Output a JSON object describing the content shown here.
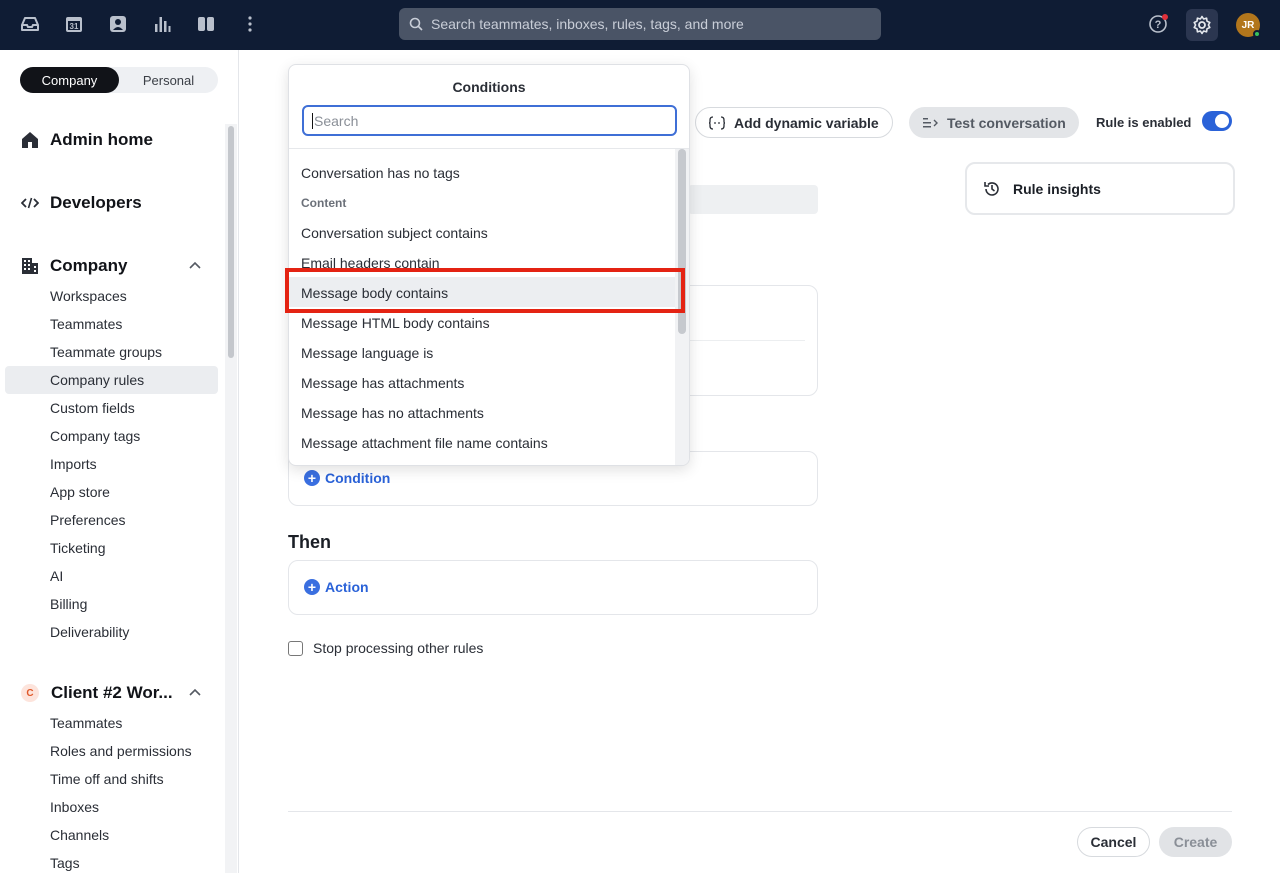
{
  "topbar": {
    "search_placeholder": "Search teammates, inboxes, rules, tags, and more",
    "avatar_initials": "JR",
    "calendar_day": "31",
    "icons": [
      "inbox-icon",
      "calendar-icon",
      "contacts-icon",
      "analytics-icon",
      "split-view-icon",
      "more-icon",
      "search-icon",
      "help-icon",
      "settings-icon"
    ]
  },
  "sidebar": {
    "segment": {
      "company": "Company",
      "personal": "Personal"
    },
    "admin_home": "Admin home",
    "developers": "Developers",
    "company_section": "Company",
    "company_items": [
      "Workspaces",
      "Teammates",
      "Teammate groups",
      "Company rules",
      "Custom fields",
      "Company tags",
      "Imports",
      "App store",
      "Preferences",
      "Ticketing",
      "AI",
      "Billing",
      "Deliverability"
    ],
    "workspace_badge": "C",
    "workspace_section": "Client #2 Wor...",
    "workspace_items": [
      "Teammates",
      "Roles and permissions",
      "Time off and shifts",
      "Inboxes",
      "Channels",
      "Tags"
    ]
  },
  "main": {
    "add_dynamic_variable": "Add dynamic variable",
    "test_conversation": "Test conversation",
    "rule_enabled_label": "Rule is enabled",
    "rule_enabled": true,
    "rule_insights": "Rule insights",
    "condition_link": "Condition",
    "then_title": "Then",
    "action_link": "Action",
    "stop_processing": "Stop processing other rules",
    "cancel": "Cancel",
    "create": "Create"
  },
  "dropdown": {
    "title": "Conditions",
    "search_placeholder": "Search",
    "items": [
      {
        "kind": "item",
        "label": "Conversation has no tags"
      },
      {
        "kind": "section",
        "label": "Content"
      },
      {
        "kind": "item",
        "label": "Conversation subject contains"
      },
      {
        "kind": "item",
        "label": "Email headers contain"
      },
      {
        "kind": "item",
        "label": "Message body contains",
        "highlighted": true
      },
      {
        "kind": "item",
        "label": "Message HTML body contains"
      },
      {
        "kind": "item",
        "label": "Message language is"
      },
      {
        "kind": "item",
        "label": "Message has attachments"
      },
      {
        "kind": "item",
        "label": "Message has no attachments"
      },
      {
        "kind": "item",
        "label": "Message attachment file name contains"
      }
    ]
  },
  "colors": {
    "topbar_bg": "#0f1c34",
    "accent": "#2a62d8",
    "highlight_box": "#e42313"
  }
}
